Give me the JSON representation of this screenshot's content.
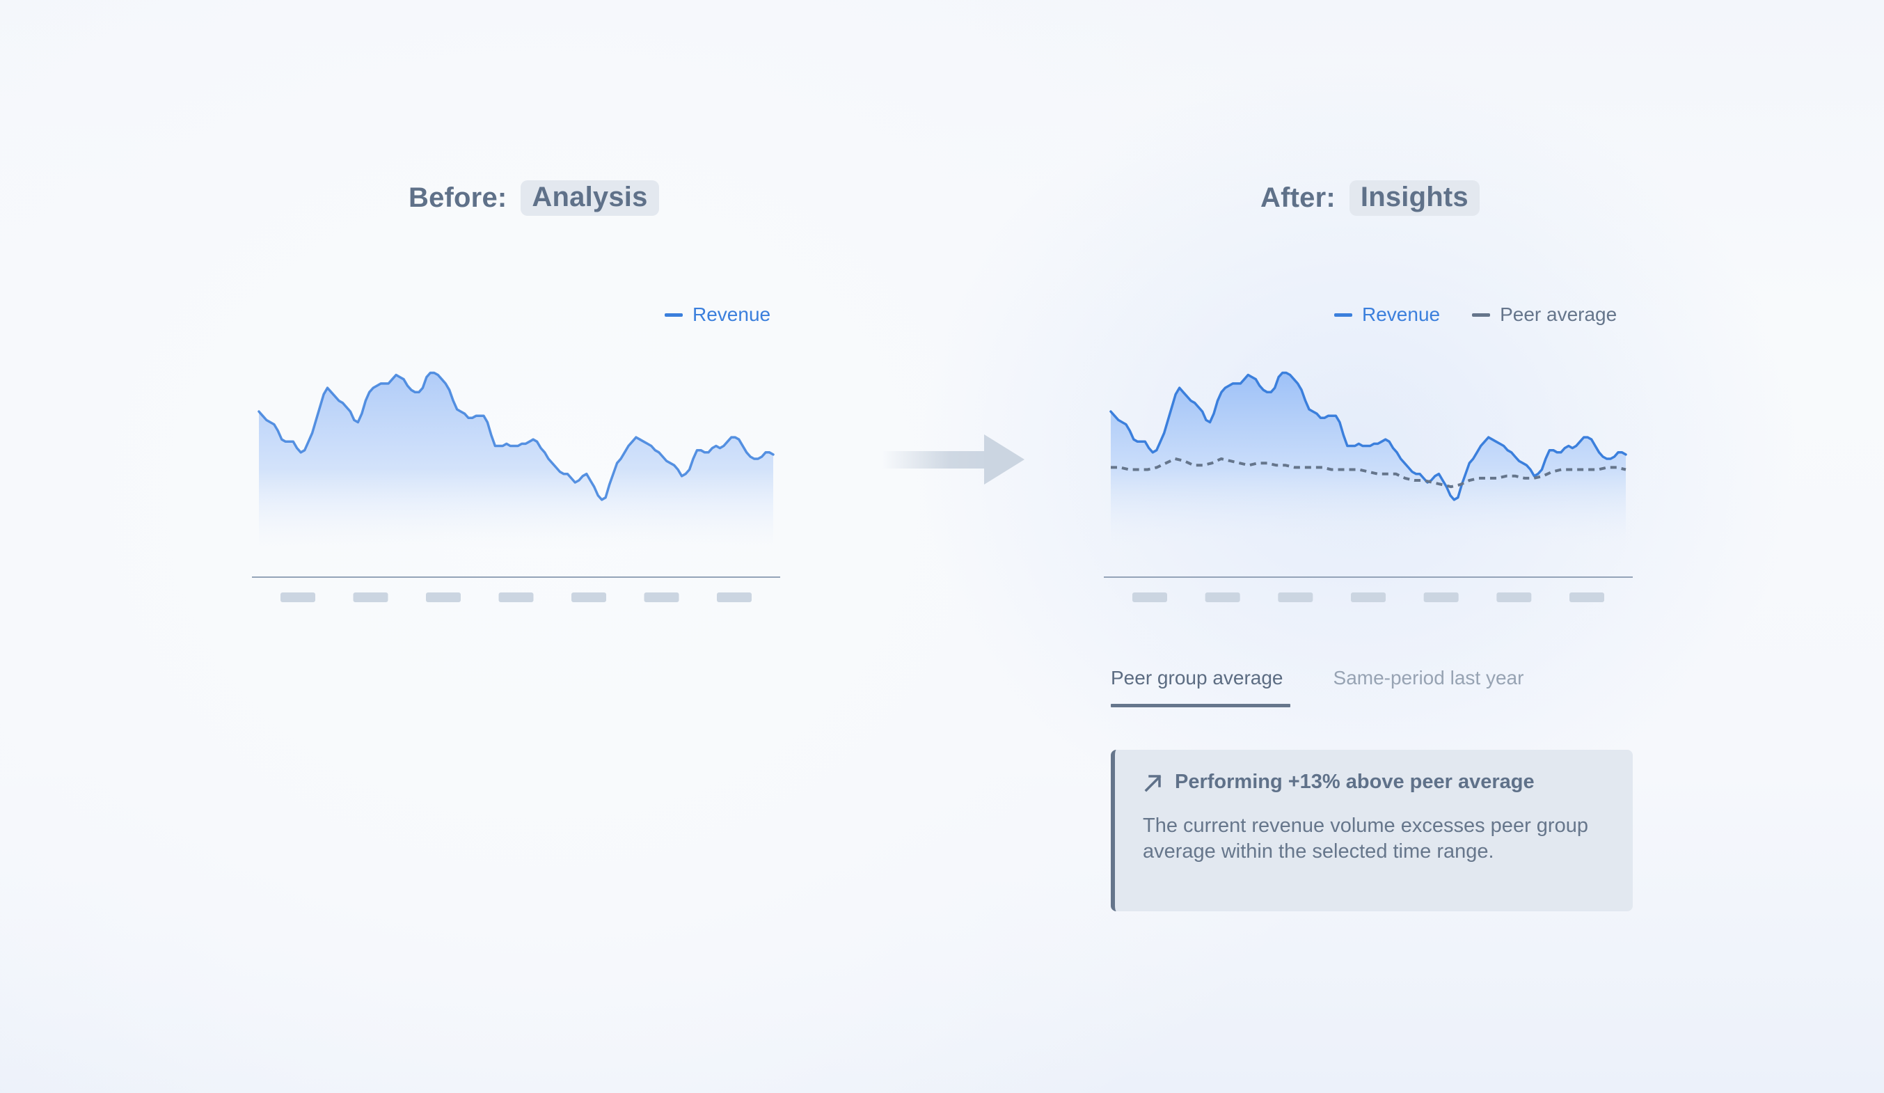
{
  "before": {
    "label": "Before:",
    "tag": "Analysis"
  },
  "after": {
    "label": "After:",
    "tag": "Insights"
  },
  "colors": {
    "revenue": "#3b7fdc",
    "peer": "#65758b",
    "fill_top": "#a9c8f8",
    "tick_placeholder": "#cbd5e1",
    "axis": "#94a3b8"
  },
  "arrow": {
    "icon": "arrow-right-icon"
  },
  "tabs": [
    {
      "label": "Peer group average",
      "active": true
    },
    {
      "label": "Same-period last year",
      "active": false
    }
  ],
  "insight": {
    "icon": "arrow-up-right-icon",
    "title": "Performing +13% above peer average",
    "body": "The current revenue volume excesses peer group average within the selected time range."
  },
  "chart_data": [
    {
      "type": "area",
      "title": "Before: Analysis",
      "legend": [
        "Revenue"
      ],
      "legend_position": "top-right",
      "xlabel": "",
      "ylabel": "",
      "x_tick_count": 7,
      "x_tick_labels": [
        "",
        "",
        "",
        "",
        "",
        "",
        ""
      ],
      "ylim": [
        0,
        100
      ],
      "grid": false,
      "series": [
        {
          "name": "Revenue",
          "values": [
            77,
            75,
            73,
            72,
            71,
            68,
            64,
            63,
            63,
            63,
            60,
            58,
            59,
            63,
            67,
            73,
            79,
            85,
            88,
            86,
            84,
            82,
            81,
            79,
            77,
            73,
            72,
            76,
            82,
            86,
            88,
            89,
            90,
            90,
            90,
            92,
            94,
            93,
            92,
            89,
            87,
            86,
            86,
            88,
            93,
            95,
            95,
            94,
            92,
            90,
            87,
            82,
            78,
            77,
            76,
            74,
            74,
            75,
            75,
            75,
            72,
            66,
            61,
            61,
            61,
            62,
            61,
            61,
            61,
            62,
            62,
            63,
            64,
            63,
            60,
            58,
            55,
            53,
            51,
            49,
            48,
            48,
            46,
            44,
            45,
            47,
            48,
            45,
            42,
            38,
            36,
            37,
            43,
            48,
            53,
            55,
            58,
            61,
            63,
            65,
            64,
            63,
            62,
            61,
            59,
            58,
            56,
            54,
            53,
            52,
            50,
            47,
            48,
            50,
            55,
            59,
            59,
            58,
            58,
            60,
            61,
            60,
            61,
            63,
            65,
            65,
            64,
            61,
            58,
            56,
            55,
            55,
            56,
            58,
            58,
            57
          ]
        }
      ]
    },
    {
      "type": "area",
      "title": "After: Insights",
      "legend": [
        "Revenue",
        "Peer average"
      ],
      "legend_position": "top-right",
      "xlabel": "",
      "ylabel": "",
      "x_tick_count": 7,
      "x_tick_labels": [
        "",
        "",
        "",
        "",
        "",
        "",
        ""
      ],
      "ylim": [
        0,
        100
      ],
      "grid": false,
      "series": [
        {
          "name": "Revenue",
          "values": [
            77,
            75,
            73,
            72,
            71,
            68,
            64,
            63,
            63,
            63,
            60,
            58,
            59,
            63,
            67,
            73,
            79,
            85,
            88,
            86,
            84,
            82,
            81,
            79,
            77,
            73,
            72,
            76,
            82,
            86,
            88,
            89,
            90,
            90,
            90,
            92,
            94,
            93,
            92,
            89,
            87,
            86,
            86,
            88,
            93,
            95,
            95,
            94,
            92,
            90,
            87,
            82,
            78,
            77,
            76,
            74,
            74,
            75,
            75,
            75,
            72,
            66,
            61,
            61,
            61,
            62,
            61,
            61,
            61,
            62,
            62,
            63,
            64,
            63,
            60,
            58,
            55,
            53,
            51,
            49,
            48,
            48,
            46,
            44,
            45,
            47,
            48,
            45,
            42,
            38,
            36,
            37,
            43,
            48,
            53,
            55,
            58,
            61,
            63,
            65,
            64,
            63,
            62,
            61,
            59,
            58,
            56,
            54,
            53,
            52,
            50,
            47,
            48,
            50,
            55,
            59,
            59,
            58,
            58,
            60,
            61,
            60,
            61,
            63,
            65,
            65,
            64,
            61,
            58,
            56,
            55,
            55,
            56,
            58,
            58,
            57
          ]
        },
        {
          "name": "Peer average",
          "style": "dashed",
          "values": [
            51,
            51,
            50,
            50,
            50,
            51,
            53,
            55,
            54,
            52,
            52,
            53,
            55,
            54,
            53,
            52,
            53,
            53,
            52,
            52,
            51,
            51,
            51,
            51,
            50,
            50,
            50,
            50,
            49,
            48,
            48,
            48,
            46,
            45,
            45,
            44,
            43,
            42,
            43,
            45,
            46,
            46,
            46,
            47,
            47,
            46,
            46,
            47,
            49,
            50,
            50,
            50,
            50,
            50,
            51,
            51,
            50
          ]
        }
      ]
    }
  ]
}
